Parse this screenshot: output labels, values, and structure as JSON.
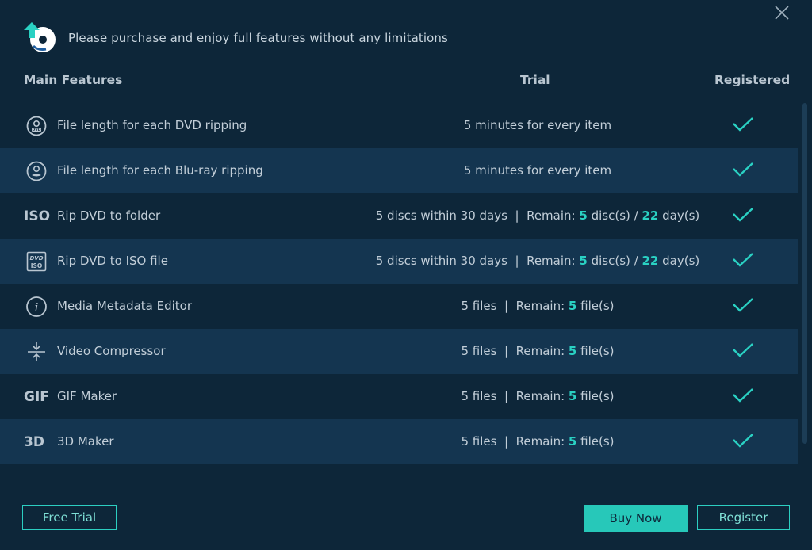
{
  "dialog": {
    "header_text": "Please purchase and enjoy full features without any limitations"
  },
  "columns": {
    "main": "Main Features",
    "trial": "Trial",
    "registered": "Registered"
  },
  "features": [
    {
      "icon": "dvd-disc-icon",
      "name": "File length for each DVD ripping",
      "trial": {
        "text": "5 minutes for every item"
      }
    },
    {
      "icon": "bluray-disc-icon",
      "name": "File length for each Blu-ray ripping",
      "trial": {
        "text": "5 minutes for every item"
      }
    },
    {
      "icon_text": "ISO",
      "icon": "iso-icon",
      "name": "Rip DVD to folder",
      "trial": {
        "limit": "5 discs within 30 days",
        "sep": "|",
        "remain_label": "Remain:",
        "v1": "5",
        "u1": "disc(s) /",
        "v2": "22",
        "u2": "day(s)"
      }
    },
    {
      "icon": "dvd-iso-icon",
      "name": "Rip DVD to ISO file",
      "trial": {
        "limit": "5 discs within 30 days",
        "sep": "|",
        "remain_label": "Remain:",
        "v1": "5",
        "u1": "disc(s) /",
        "v2": "22",
        "u2": "day(s)"
      }
    },
    {
      "icon": "info-icon",
      "name": "Media Metadata Editor",
      "trial": {
        "limit": "5 files",
        "sep": "|",
        "remain_label": "Remain:",
        "v1": "5",
        "u1": "file(s)"
      }
    },
    {
      "icon": "compress-icon",
      "name": "Video Compressor",
      "trial": {
        "limit": "5 files",
        "sep": "|",
        "remain_label": "Remain:",
        "v1": "5",
        "u1": "file(s)"
      }
    },
    {
      "icon_text": "GIF",
      "icon": "gif-icon",
      "name": "GIF Maker",
      "trial": {
        "limit": "5 files",
        "sep": "|",
        "remain_label": "Remain:",
        "v1": "5",
        "u1": "file(s)"
      }
    },
    {
      "icon_text": "3D",
      "icon": "3d-icon",
      "name": "3D Maker",
      "trial": {
        "limit": "5 files",
        "sep": "|",
        "remain_label": "Remain:",
        "v1": "5",
        "u1": "file(s)"
      }
    }
  ],
  "buttons": {
    "free_trial": "Free Trial",
    "buy_now": "Buy Now",
    "register": "Register"
  },
  "colors": {
    "background": "#0d2639",
    "row_alt": "#143550",
    "accent": "#2ad1c3"
  }
}
